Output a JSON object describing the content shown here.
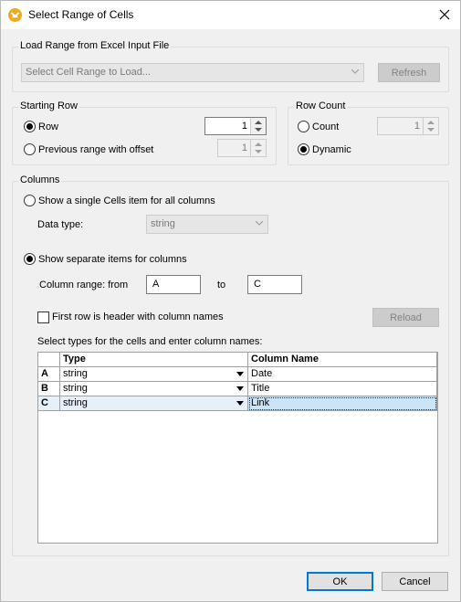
{
  "window": {
    "title": "Select Range of Cells"
  },
  "load_range": {
    "group_label": "Load Range from Excel Input File",
    "combo_placeholder": "Select Cell Range to Load...",
    "refresh_label": "Refresh"
  },
  "starting_row": {
    "group_label": "Starting Row",
    "row_label": "Row",
    "row_value": "1",
    "previous_label": "Previous range with offset",
    "offset_value": "1",
    "selected": "row"
  },
  "row_count": {
    "group_label": "Row Count",
    "count_label": "Count",
    "count_value": "1",
    "dynamic_label": "Dynamic",
    "selected": "dynamic"
  },
  "columns": {
    "group_label": "Columns",
    "single_label": "Show a single Cells item for all columns",
    "data_type_label": "Data type:",
    "data_type_value": "string",
    "separate_label": "Show separate items for columns",
    "selected": "separate",
    "range_label": "Column range: from",
    "range_from": "A",
    "to_label": "to",
    "range_to": "C",
    "header_checkbox_label": "First row is header with column names",
    "header_checked": false,
    "reload_label": "Reload",
    "grid_instruction": "Select types for the cells and enter column names:",
    "grid": {
      "headers": [
        "",
        "Type",
        "Column Name"
      ],
      "rows": [
        {
          "letter": "A",
          "type": "string",
          "name": "Date"
        },
        {
          "letter": "B",
          "type": "string",
          "name": "Title"
        },
        {
          "letter": "C",
          "type": "string",
          "name": "Link"
        }
      ],
      "selected_row": "C"
    }
  },
  "footer": {
    "ok_label": "OK",
    "cancel_label": "Cancel"
  },
  "colors": {
    "accent": "#0078d7",
    "app_icon": "#f3a81b",
    "selection": "#cce4f7"
  }
}
